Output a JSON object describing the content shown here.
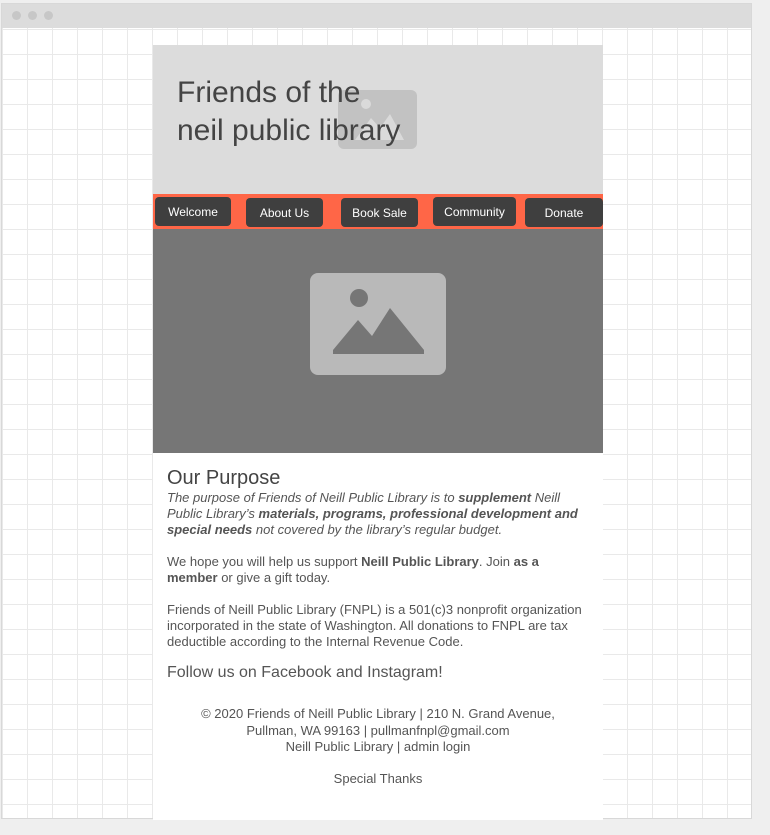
{
  "site": {
    "title_line1": "Friends of the",
    "title_line2": "neil public library"
  },
  "nav": {
    "items": [
      "Welcome",
      "About Us",
      "Book Sale",
      "Community",
      "Donate"
    ]
  },
  "content": {
    "heading": "Our Purpose",
    "purpose": {
      "t1": "The purpose of Friends of Neill Public Library is to ",
      "b1": "supplement",
      "t2": " Neill Public Library’s ",
      "b2": "materials, programs, professional development and special needs",
      "t3": " not covered by the library’s regular budget."
    },
    "support": {
      "t1": "We hope you will help us support ",
      "b1": "Neill Public Library",
      "t2": ". Join ",
      "b2": "as a member",
      "t3": " or give a gift today."
    },
    "fnpl": "Friends of Neill Public Library (FNPL) is a 501(c)3 nonprofit organization incorporated in the state of Washington. All donations to FNPL are tax deductible according to the Internal Revenue Code.",
    "follow": "Follow us on Facebook and Instagram!"
  },
  "footer": {
    "line1": "© 2020 Friends of Neill Public Library | 210 N. Grand Avenue,",
    "line2": "Pullman, WA 99163 | pullmanfnpl@gmail.com",
    "library_link": "Neill Public Library",
    "separator": " | ",
    "admin_link": "admin login",
    "thanks": "Special Thanks"
  },
  "colors": {
    "nav_bar": "#ff6647",
    "nav_button": "#3f3f3f",
    "header_bg": "#dcdcdc",
    "hero_bg": "#767676"
  },
  "icons": [
    "image-placeholder-icon"
  ]
}
